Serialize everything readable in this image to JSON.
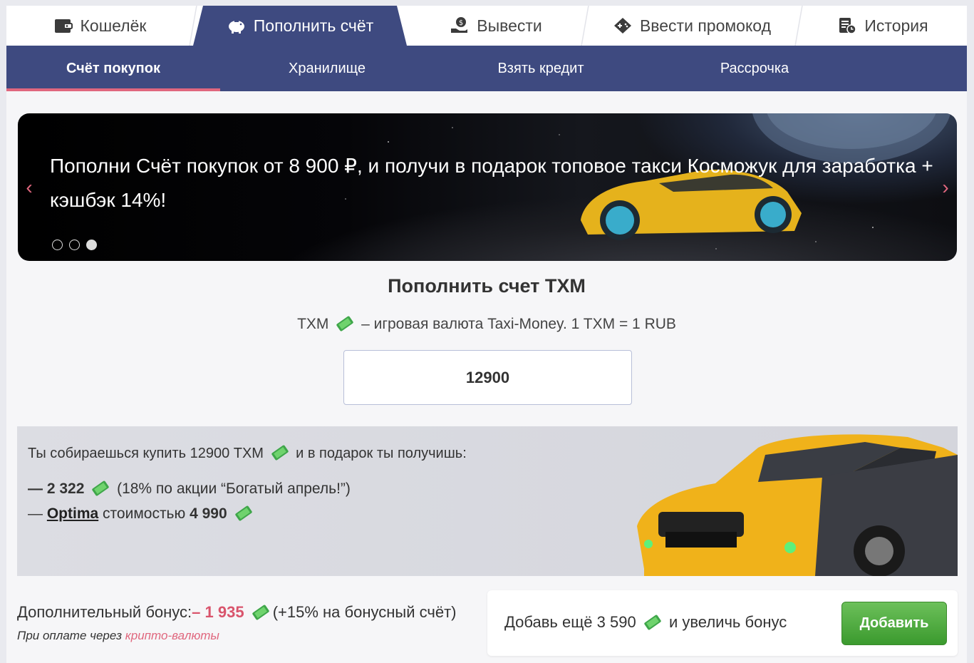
{
  "top_tabs": [
    {
      "label": "Кошелёк",
      "icon": "wallet-icon"
    },
    {
      "label": "Пополнить счёт",
      "icon": "piggy-bank-icon"
    },
    {
      "label": "Вывести",
      "icon": "hand-money-icon"
    },
    {
      "label": "Ввести промокод",
      "icon": "gamepad-icon"
    },
    {
      "label": "История",
      "icon": "history-icon"
    }
  ],
  "sub_nav": [
    "Счёт покупок",
    "Хранилище",
    "Взять кредит",
    "Рассрочка"
  ],
  "banner": {
    "text": "Пополни Счёт покупок от 8 900 ₽, и получи в подарок топовое такси Косможук для заработка + кэшбэк 14%!",
    "prev": "‹",
    "next": "›"
  },
  "section": {
    "title": "Пополнить счет TXM",
    "sub_prefix": "TXM",
    "sub_suffix": "– игровая валюта Taxi-Money. 1 TXM = 1 RUB",
    "amount": "12900"
  },
  "gift": {
    "line1_a": "Ты собираешься купить 12900 TXM",
    "line1_b": "и в подарок ты получишь:",
    "line2_amount": "— 2 322",
    "line2_note": "(18% по акции “Богатый апрель!”)",
    "line3_dash": "—",
    "line3_link": "Optima",
    "line3_mid": "стоимостью",
    "line3_price": "4 990"
  },
  "bonus": {
    "label": "Дополнительный бонус:",
    "amount": "– 1 935",
    "note": "(+15% на бонусный счёт)",
    "pay_prefix": "При оплате через",
    "pay_link": "крипто-валюты"
  },
  "add": {
    "text_a": "Добавь ещё 3 590",
    "text_b": "и увеличь бонус",
    "button": "Добавить"
  },
  "colors": {
    "nav": "#3e4a80",
    "accent": "#e0677e",
    "button": "#4caf3e"
  }
}
